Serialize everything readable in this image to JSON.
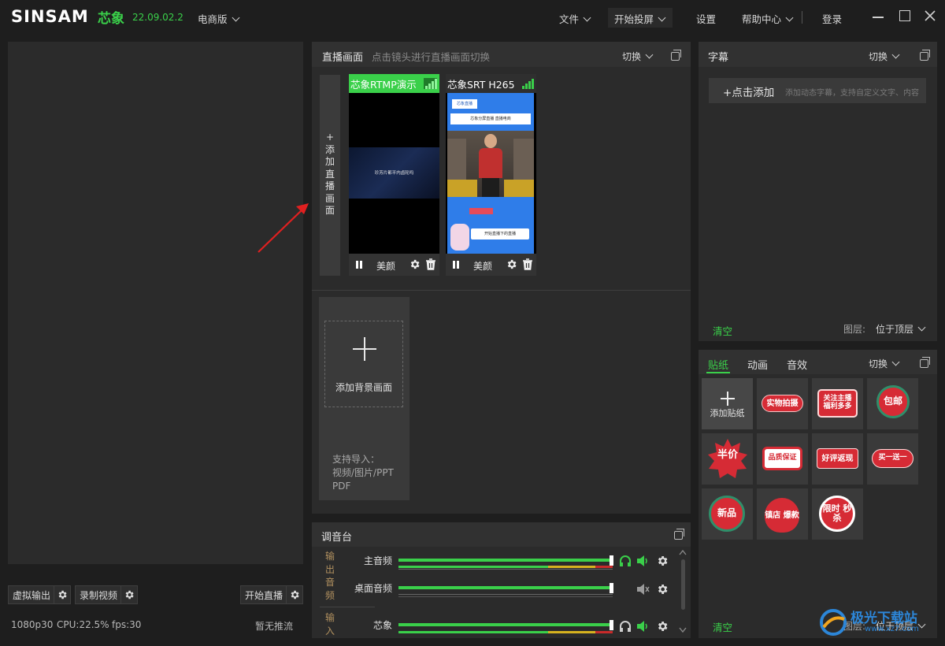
{
  "app": {
    "logo": "SINSAM",
    "logo_cn": "芯象",
    "version": "22.09.02.2",
    "edition": "电商版"
  },
  "topmenu": {
    "file": "文件",
    "start_cast": "开始投屏",
    "settings": "设置",
    "help": "帮助中心",
    "login": "登录"
  },
  "left": {
    "virtual_output": "虚拟输出",
    "record_video": "录制视频",
    "start_live": "开始直播",
    "stats": {
      "resolution": "1080p30",
      "cpu": "CPU:22.5%",
      "fps": "fps:30"
    },
    "push_status": "暂无推流"
  },
  "live_panel": {
    "title": "直播画面",
    "hint": "点击镜头进行直播画面切换",
    "switch": "切换",
    "add_scene": [
      "+",
      "添",
      "加",
      "直",
      "播",
      "画",
      "面"
    ],
    "scenes": [
      {
        "title": "芯象RTMP演示",
        "beauty": "美颜",
        "overlay_text": "珍芳片都平内卤轮吗"
      },
      {
        "title": "芯象SRT H265",
        "beauty": "美颜",
        "overlay_top": "芯象直播",
        "overlay_sub": "芯象分屏直播 直播电商",
        "overlay_bottom": "开始直播下的直播"
      }
    ],
    "add_bg": "添加背景画面",
    "import_hint": [
      "支持导入：",
      "视频/图片/PPT",
      "PDF"
    ]
  },
  "subtitle_panel": {
    "title": "字幕",
    "switch": "切换",
    "add": "+点击添加",
    "add_hint": "添加动态字幕，支持自定义文字、内容",
    "clear": "清空",
    "layer_label": "图层:",
    "layer_value": "位于顶层"
  },
  "sticker_panel": {
    "tabs": [
      "贴纸",
      "动画",
      "音效"
    ],
    "switch": "切换",
    "add_sticker": "添加贴纸",
    "stickers": [
      "实物拍摄",
      "关注主播 福利多多",
      "包邮",
      "半价",
      "品质保证",
      "好评返现",
      "买一送一",
      "新品",
      "镇店 爆款",
      "限时 秒杀"
    ],
    "clear": "清空",
    "layer_label": "图层:",
    "layer_value": "位于顶层"
  },
  "mixer": {
    "title": "调音台",
    "output_label": [
      "输",
      "出",
      "音",
      "频"
    ],
    "input_label": [
      "输",
      "入"
    ],
    "channels": [
      {
        "name": "主音频",
        "level": 0.95
      },
      {
        "name": "桌面音频",
        "level": 0.95
      },
      {
        "name": "芯象",
        "level": 0.95
      }
    ]
  },
  "watermark": {
    "text": "极光下载站",
    "url": "www.xz7.com"
  },
  "colors": {
    "accent": "#3ad04a",
    "panel": "#2b2b2b",
    "header": "#313131",
    "red": "#d62b35"
  }
}
